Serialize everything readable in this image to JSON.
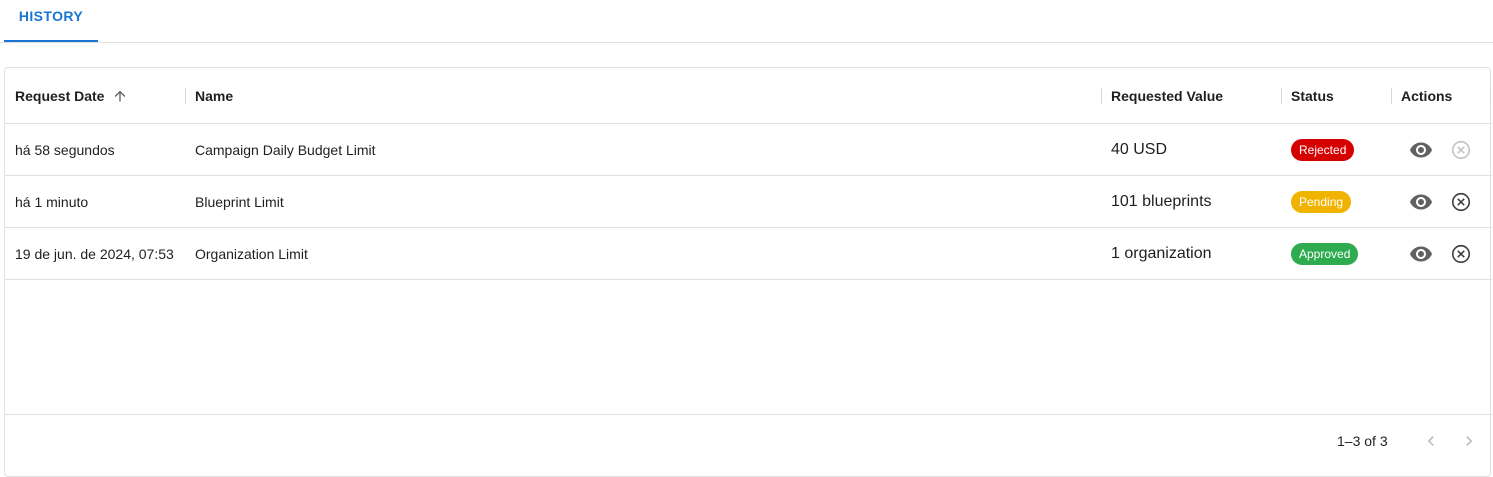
{
  "tabs": [
    {
      "label": "HISTORY",
      "active": true
    }
  ],
  "table": {
    "columns": {
      "request_date": "Request Date",
      "name": "Name",
      "requested_value": "Requested Value",
      "status": "Status",
      "actions": "Actions"
    },
    "sort": {
      "column": "request_date",
      "direction": "ascending",
      "icon": "arrow-up-icon"
    },
    "rows": [
      {
        "request_date": "há 58 segundos",
        "name": "Campaign Daily Budget Limit",
        "requested_value": "40 USD",
        "status": "Rejected",
        "status_color": "#d50000",
        "cancel_enabled": false
      },
      {
        "request_date": "há 1 minuto",
        "name": "Blueprint Limit",
        "requested_value": "101 blueprints",
        "status": "Pending",
        "status_color": "#f0b400",
        "cancel_enabled": true
      },
      {
        "request_date": "19 de jun. de 2024, 07:53",
        "name": "Organization Limit",
        "requested_value": "1 organization",
        "status": "Approved",
        "status_color": "#2eaa4f",
        "cancel_enabled": true
      }
    ]
  },
  "pagination": {
    "label": "1–3 of 3",
    "prev_enabled": false,
    "next_enabled": false
  },
  "colors": {
    "accent": "#1976d2",
    "border": "#e0e0e0",
    "icon": "#616161",
    "disabled_icon": "#bdbdbd"
  }
}
